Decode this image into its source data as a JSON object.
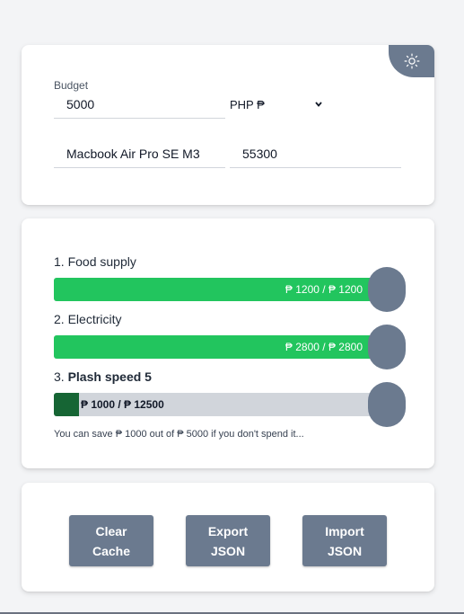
{
  "settings": {
    "budget_label": "Budget",
    "budget_value": "5000",
    "currency_selected": "PHP ₱",
    "item_name_value": "Macbook Air Pro SE M3",
    "item_price_value": "55300"
  },
  "items": [
    {
      "index": "1.",
      "name": "Food supply",
      "bold": false,
      "spent": 1200,
      "total": 1200,
      "progress": 1.0,
      "bar_text": "₱ 1200 / ₱ 1200",
      "fill_color": "#22c55e"
    },
    {
      "index": "2.",
      "name": "Electricity",
      "bold": false,
      "spent": 2800,
      "total": 2800,
      "progress": 1.0,
      "bar_text": "₱ 2800 / ₱ 2800",
      "fill_color": "#22c55e"
    },
    {
      "index": "3.",
      "name": "Plash speed 5",
      "bold": true,
      "spent": 1000,
      "total": 12500,
      "progress": 0.08,
      "bar_text": "₱ 1000 / ₱ 12500",
      "fill_color": "#166534"
    }
  ],
  "savings_note": "You can save ₱ 1000 out of ₱ 5000 if you don't spend it...",
  "actions": {
    "clear_cache": "Clear Cache",
    "export_json": "Export JSON",
    "import_json": "Import JSON"
  },
  "colors": {
    "accent": "#6b7a8f",
    "complete": "#22c55e",
    "partial": "#166534",
    "track": "#d1d5db"
  },
  "icons": {
    "theme_toggle": "sun-icon",
    "select_arrow": "chevron-down-icon"
  }
}
